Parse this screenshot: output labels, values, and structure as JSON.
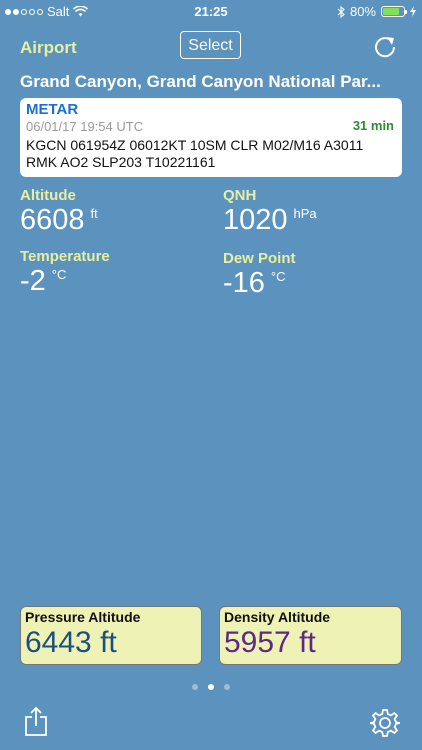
{
  "status_bar": {
    "carrier": "Salt",
    "time": "21:25",
    "battery_percent": "80%",
    "battery_level": 0.8,
    "icons": [
      "signal-dots-icon",
      "wifi-icon",
      "bluetooth-icon",
      "battery-icon",
      "charging-bolt-icon"
    ]
  },
  "header": {
    "title": "Airport",
    "select_label": "Select",
    "refresh_icon": "refresh-icon"
  },
  "airport": {
    "name": "Grand Canyon, Grand Canyon National Par..."
  },
  "metar": {
    "label": "METAR",
    "timestamp": "06/01/17 19:54 UTC",
    "age": "31 min",
    "raw": "KGCN 061954Z 06012KT 10SM CLR M02/M16 A3011 RMK AO2 SLP203 T10221161"
  },
  "values": {
    "altitude": {
      "label": "Altitude",
      "value": "6608",
      "unit": "ft"
    },
    "qnh": {
      "label": "QNH",
      "value": "1020",
      "unit": "hPa"
    },
    "temperature": {
      "label": "Temperature",
      "value": "-2",
      "unit": "°C"
    },
    "dew_point": {
      "label": "Dew Point",
      "value": "-16",
      "unit": "°C"
    }
  },
  "results": {
    "pressure_altitude": {
      "label": "Pressure Altitude",
      "value": "6443 ft",
      "color": "#1c4f80"
    },
    "density_altitude": {
      "label": "Density Altitude",
      "value": "5957 ft",
      "color": "#5a2a86"
    }
  },
  "pager": {
    "count": 3,
    "active_index": 1
  },
  "toolbar": {
    "share_icon": "share-icon",
    "settings_icon": "gear-icon"
  },
  "colors": {
    "background": "#5b93be",
    "accent_label": "#e8f0a0",
    "metar_label": "#1a6fd0",
    "age": "#2e8b2e"
  }
}
